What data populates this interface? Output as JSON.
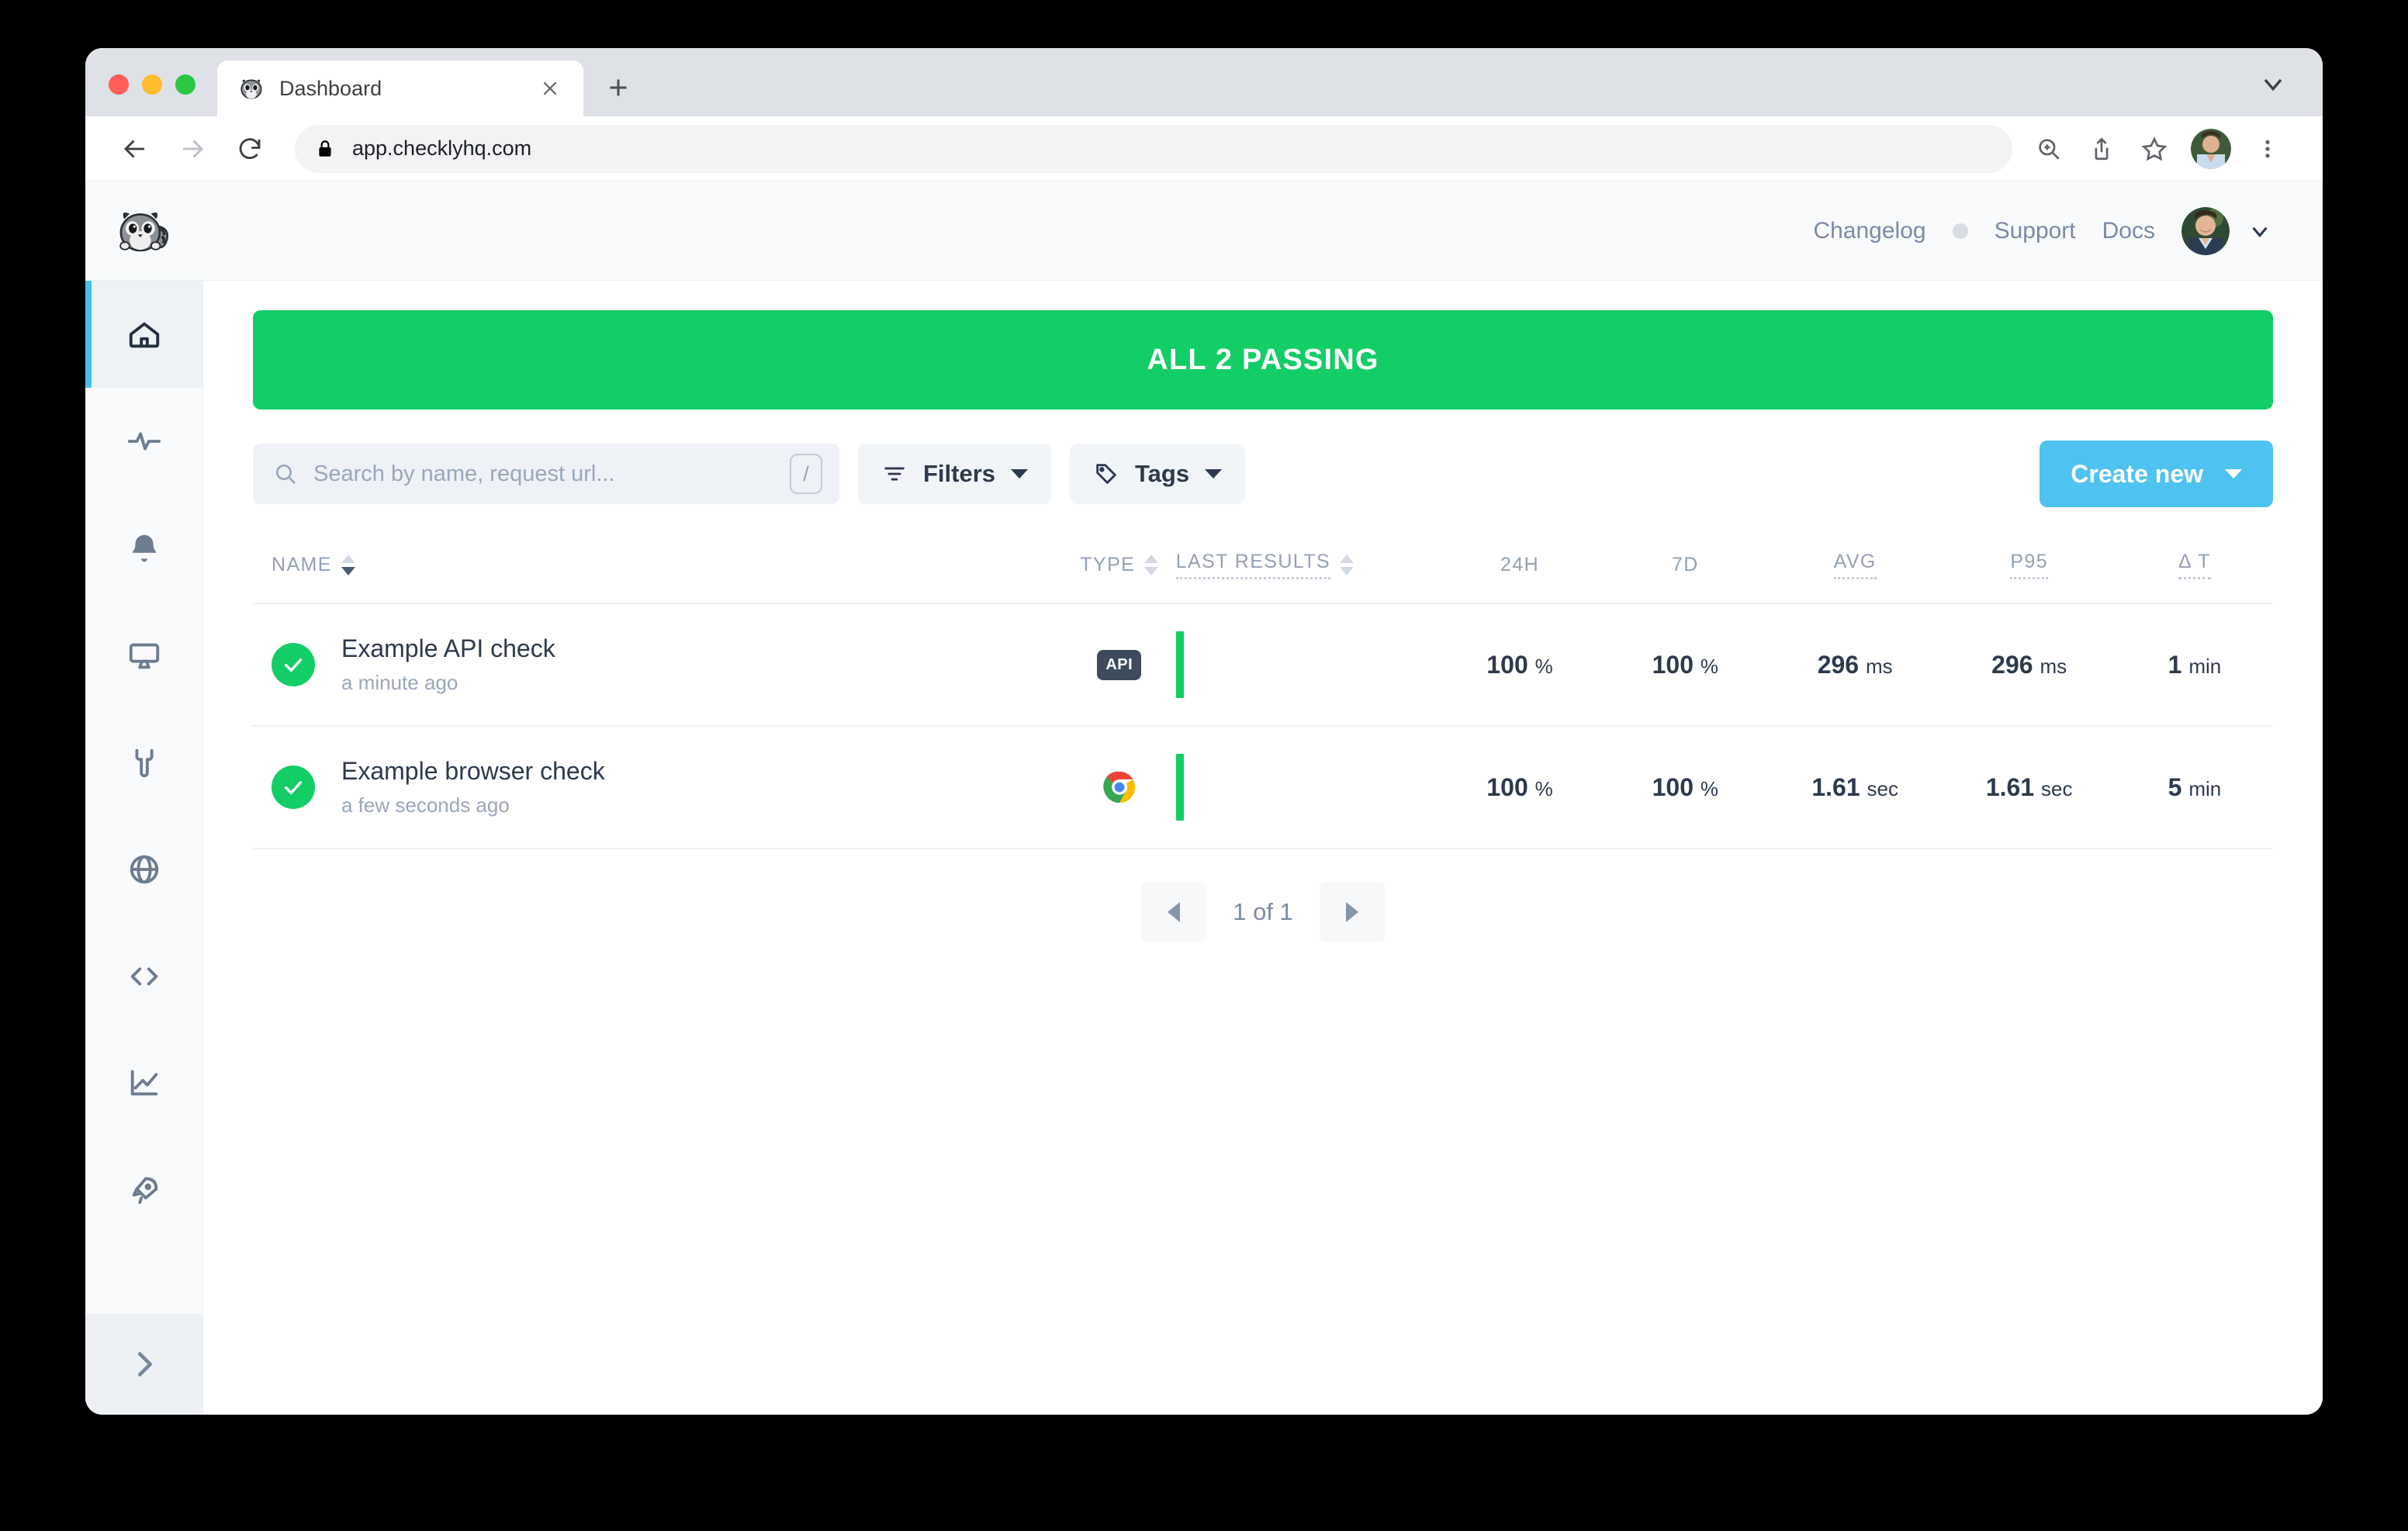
{
  "browser": {
    "tab": {
      "title": "Dashboard",
      "favicon_icon": "checkly-raccoon-favicon",
      "close_icon": "close-icon"
    },
    "new_tab_icon": "plus-icon",
    "tabstrip_chevron_icon": "chevron-down-icon",
    "back_icon": "back-arrow-icon",
    "forward_icon": "forward-arrow-icon",
    "reload_icon": "reload-icon",
    "lock_icon": "lock-icon",
    "url": "app.checklyhq.com",
    "zoom_icon": "zoom-in-icon",
    "share_icon": "share-icon",
    "bookmark_icon": "star-icon",
    "profile_icon": "profile-avatar",
    "menu_icon": "three-dot-menu-icon"
  },
  "header": {
    "logo_icon": "checkly-raccoon-logo",
    "nav": [
      {
        "label": "Changelog",
        "name": "changelog"
      },
      {
        "label": "Support",
        "name": "support"
      },
      {
        "label": "Docs",
        "name": "docs"
      }
    ],
    "changelog_dot_color": "#d8dce3",
    "avatar_icon": "user-avatar",
    "chevron_icon": "chevron-down-icon"
  },
  "sidebar": {
    "items": [
      {
        "name": "home",
        "icon": "home-icon",
        "active": true
      },
      {
        "name": "activity",
        "icon": "activity-pulse-icon",
        "active": false
      },
      {
        "name": "alerts",
        "icon": "bell-icon",
        "active": false
      },
      {
        "name": "dashboards",
        "icon": "monitor-icon",
        "active": false
      },
      {
        "name": "maintenance",
        "icon": "wrench-icon",
        "active": false
      },
      {
        "name": "locations",
        "icon": "globe-icon",
        "active": false
      },
      {
        "name": "code",
        "icon": "code-brackets-icon",
        "active": false
      },
      {
        "name": "analytics",
        "icon": "line-chart-icon",
        "active": false
      },
      {
        "name": "deployments",
        "icon": "rocket-icon",
        "active": false
      }
    ],
    "expand": {
      "name": "expand-sidebar",
      "icon": "chevron-right-icon"
    },
    "active_accent": "#49c0ef"
  },
  "status_banner": {
    "label": "ALL 2 PASSING",
    "color": "#13cd66"
  },
  "controls": {
    "search": {
      "placeholder": "Search by name, request url...",
      "value": "",
      "icon": "search-icon",
      "shortcut_key": "/"
    },
    "filters": {
      "label": "Filters",
      "icon": "filter-icon"
    },
    "tags": {
      "label": "Tags",
      "icon": "tag-icon"
    },
    "create_new": {
      "label": "Create new",
      "color": "#4fc3f0"
    }
  },
  "table": {
    "columns": [
      {
        "key": "name",
        "label": "NAME",
        "sortable": true,
        "sorted": "desc"
      },
      {
        "key": "type",
        "label": "TYPE",
        "sortable": true,
        "sorted": null
      },
      {
        "key": "last_results",
        "label": "LAST RESULTS",
        "sortable": true,
        "sorted": null,
        "dotted": true
      },
      {
        "key": "h24",
        "label": "24H",
        "sortable": false,
        "dotted": false
      },
      {
        "key": "d7",
        "label": "7D",
        "sortable": false,
        "dotted": false
      },
      {
        "key": "avg",
        "label": "AVG",
        "sortable": false,
        "dotted": true
      },
      {
        "key": "p95",
        "label": "P95",
        "sortable": false,
        "dotted": true
      },
      {
        "key": "dt",
        "label": "Δ T",
        "sortable": false,
        "dotted": true
      }
    ],
    "rows": [
      {
        "status": "passing",
        "status_icon": "check-circle-icon",
        "name": "Example API check",
        "time": "a minute ago",
        "type": "API",
        "type_icon": "api-badge",
        "results": [
          "passing"
        ],
        "h24": "100",
        "h24_unit": "%",
        "d7": "100",
        "d7_unit": "%",
        "avg": "296",
        "avg_unit": "ms",
        "p95": "296",
        "p95_unit": "ms",
        "dt": "1",
        "dt_unit": "min"
      },
      {
        "status": "passing",
        "status_icon": "check-circle-icon",
        "name": "Example browser check",
        "time": "a few seconds ago",
        "type": "BROWSER",
        "type_icon": "chrome-icon",
        "results": [
          "passing"
        ],
        "h24": "100",
        "h24_unit": "%",
        "d7": "100",
        "d7_unit": "%",
        "avg": "1.61",
        "avg_unit": "sec",
        "p95": "1.61",
        "p95_unit": "sec",
        "dt": "5",
        "dt_unit": "min"
      }
    ]
  },
  "pagination": {
    "prev_icon": "triangle-left-icon",
    "next_icon": "triangle-right-icon",
    "label": "1 of 1"
  }
}
